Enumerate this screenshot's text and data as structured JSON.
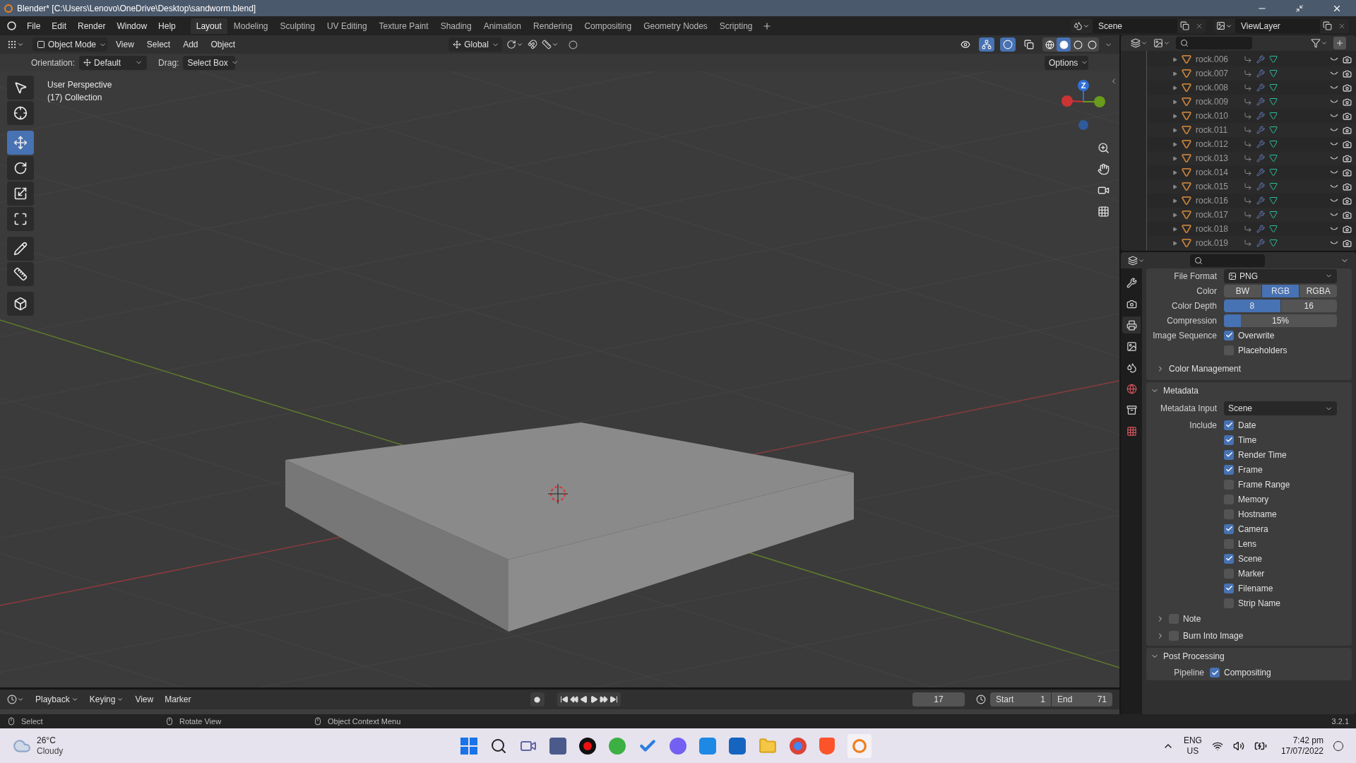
{
  "window": {
    "title": "Blender* [C:\\Users\\Lenovo\\OneDrive\\Desktop\\sandworm.blend]"
  },
  "menu": [
    "File",
    "Edit",
    "Render",
    "Window",
    "Help"
  ],
  "workspaces": [
    {
      "label": "Layout",
      "selected": true
    },
    {
      "label": "Modeling",
      "selected": false
    },
    {
      "label": "Sculpting",
      "selected": false
    },
    {
      "label": "UV Editing",
      "selected": false
    },
    {
      "label": "Texture Paint",
      "selected": false
    },
    {
      "label": "Shading",
      "selected": false
    },
    {
      "label": "Animation",
      "selected": false
    },
    {
      "label": "Rendering",
      "selected": false
    },
    {
      "label": "Compositing",
      "selected": false
    },
    {
      "label": "Geometry Nodes",
      "selected": false
    },
    {
      "label": "Scripting",
      "selected": false
    }
  ],
  "scene": {
    "value": "Scene"
  },
  "view_layer": {
    "value": "ViewLayer"
  },
  "viewport_header": {
    "mode": "Object Mode",
    "menus": [
      "View",
      "Select",
      "Add",
      "Object"
    ],
    "transform_orientation": "Global",
    "toggles": [
      {
        "kind": "visibility",
        "on": false
      },
      {
        "kind": "gizmo",
        "on": true
      },
      {
        "kind": "overlay",
        "on": true
      },
      {
        "kind": "xray",
        "on": false
      }
    ],
    "shading_modes": [
      {
        "kind": "wireframe",
        "selected": false
      },
      {
        "kind": "solid",
        "selected": true
      },
      {
        "kind": "material",
        "selected": false
      },
      {
        "kind": "rendered",
        "selected": false
      }
    ]
  },
  "tool_settings": {
    "orientation_label": "Orientation:",
    "orientation": "Default",
    "drag_label": "Drag:",
    "drag": "Select Box",
    "options": "Options"
  },
  "viewport": {
    "info": [
      "User Perspective",
      "(17) Collection"
    ],
    "gizmo_label": "Z"
  },
  "toolbar": [
    {
      "kind": "select",
      "selected": false
    },
    {
      "kind": "cursor",
      "selected": false
    },
    {
      "kind": "move",
      "selected": true
    },
    {
      "kind": "rotate",
      "selected": false
    },
    {
      "kind": "scale",
      "selected": false
    },
    {
      "kind": "transform",
      "selected": false
    },
    {
      "kind": "annotate",
      "selected": false
    },
    {
      "kind": "measure",
      "selected": false
    },
    {
      "kind": "add",
      "selected": false
    }
  ],
  "outliner": {
    "items": [
      {
        "name": "rock.006"
      },
      {
        "name": "rock.007"
      },
      {
        "name": "rock.008"
      },
      {
        "name": "rock.009"
      },
      {
        "name": "rock.010"
      },
      {
        "name": "rock.011"
      },
      {
        "name": "rock.012"
      },
      {
        "name": "rock.013"
      },
      {
        "name": "rock.014"
      },
      {
        "name": "rock.015"
      },
      {
        "name": "rock.016"
      },
      {
        "name": "rock.017"
      },
      {
        "name": "rock.018"
      },
      {
        "name": "rock.019"
      }
    ]
  },
  "properties": {
    "tabs": [
      {
        "kind": "tool",
        "selected": false
      },
      {
        "kind": "render",
        "selected": false
      },
      {
        "kind": "output",
        "selected": true
      },
      {
        "kind": "view_layer",
        "selected": false
      },
      {
        "kind": "scene",
        "selected": false
      },
      {
        "kind": "world",
        "selected": false
      },
      {
        "kind": "collection",
        "selected": false
      },
      {
        "kind": "texture",
        "selected": false
      }
    ],
    "file_format": {
      "label": "File Format",
      "value": "PNG"
    },
    "color": {
      "label": "Color",
      "options": [
        {
          "label": "BW",
          "selected": false
        },
        {
          "label": "RGB",
          "selected": true
        },
        {
          "label": "RGBA",
          "selected": false
        }
      ]
    },
    "color_depth": {
      "label": "Color Depth",
      "options": [
        {
          "label": "8",
          "selected": true
        },
        {
          "label": "16",
          "selected": false
        }
      ]
    },
    "compression": {
      "label": "Compression",
      "value": "15%",
      "level": 0.15
    },
    "image_sequence": {
      "label": "Image Sequence",
      "options": [
        {
          "label": "Overwrite",
          "checked": true
        },
        {
          "label": "Placeholders",
          "checked": false
        }
      ]
    },
    "color_management": {
      "label": "Color Management",
      "expanded": false
    },
    "metadata": {
      "title": "Metadata",
      "expanded": true,
      "input_label": "Metadata Input",
      "input": "Scene",
      "include_label": "Include",
      "include": [
        {
          "label": "Date",
          "checked": true
        },
        {
          "label": "Time",
          "checked": true
        },
        {
          "label": "Render Time",
          "checked": true
        },
        {
          "label": "Frame",
          "checked": true
        },
        {
          "label": "Frame Range",
          "checked": false
        },
        {
          "label": "Memory",
          "checked": false
        },
        {
          "label": "Hostname",
          "checked": false
        },
        {
          "label": "Camera",
          "checked": true
        },
        {
          "label": "Lens",
          "checked": false
        },
        {
          "label": "Scene",
          "checked": true
        },
        {
          "label": "Marker",
          "checked": false
        },
        {
          "label": "Filename",
          "checked": true
        },
        {
          "label": "Strip Name",
          "checked": false
        }
      ],
      "subpanels": [
        {
          "label": "Note",
          "checked": false,
          "expanded": false
        },
        {
          "label": "Burn Into Image",
          "checked": false,
          "expanded": false
        }
      ]
    },
    "post_processing": {
      "title": "Post Processing",
      "expanded": true,
      "pipeline_label": "Pipeline",
      "pipeline": [
        {
          "label": "Compositing",
          "checked": true
        }
      ]
    }
  },
  "timeline": {
    "menus": [
      "Playback",
      "Keying",
      "View",
      "Marker"
    ],
    "current_frame": "17",
    "start_label": "Start",
    "start": "1",
    "end_label": "End",
    "end": "71"
  },
  "status_bar": {
    "hints": [
      "Select",
      "Rotate View",
      "Object Context Menu"
    ],
    "version": "3.2.1"
  },
  "taskbar": {
    "temperature": "26°C",
    "weather": "Cloudy",
    "language": "ENG",
    "region": "US",
    "time": "7:42 pm",
    "date": "17/07/2022"
  }
}
